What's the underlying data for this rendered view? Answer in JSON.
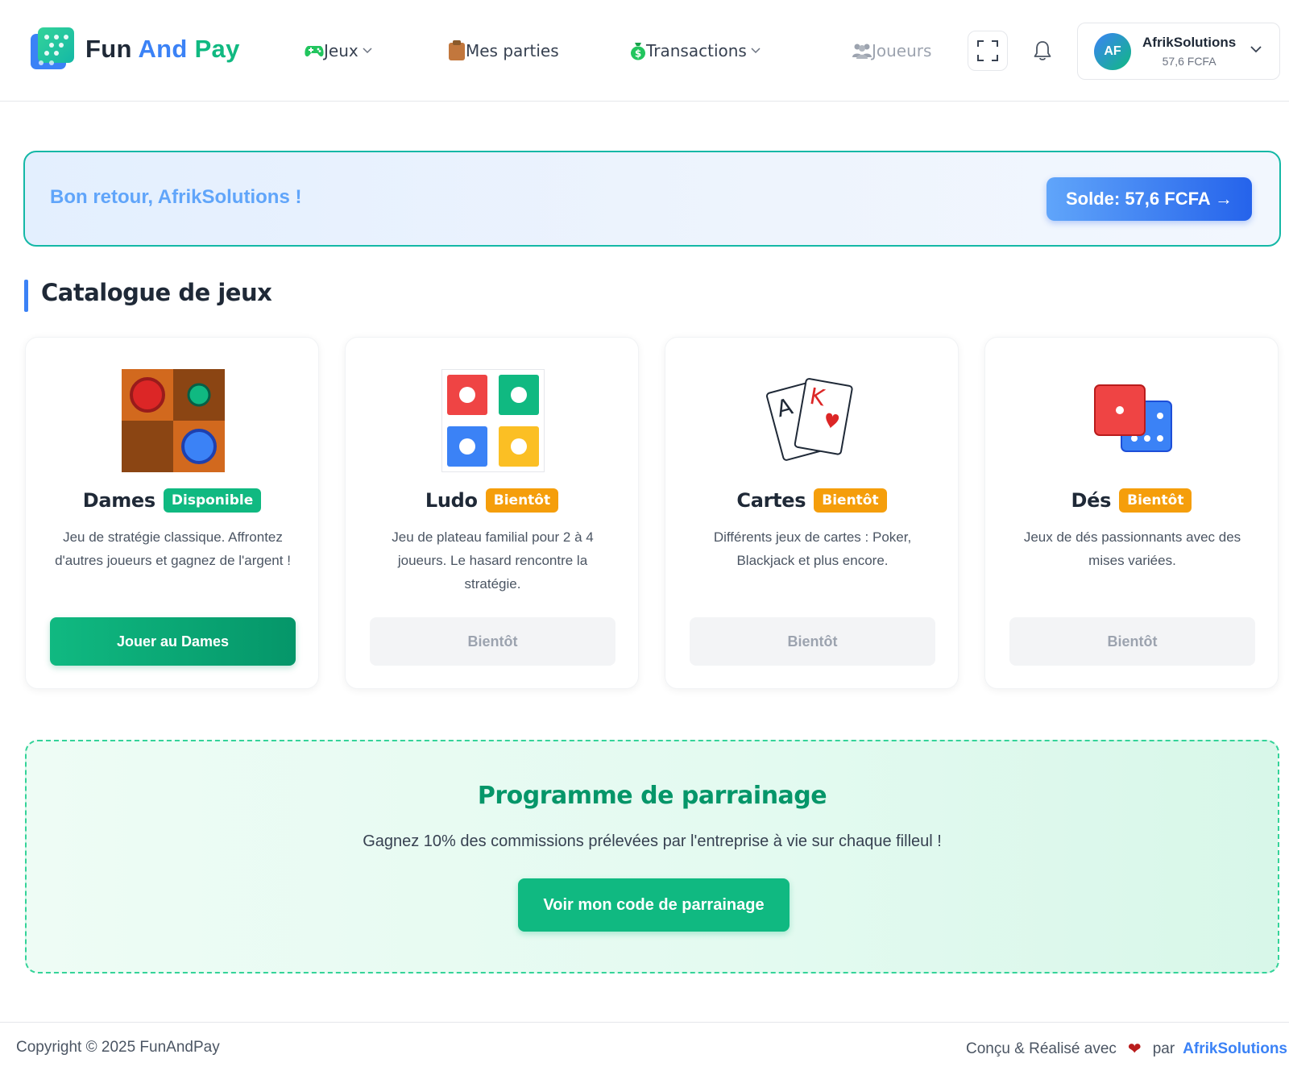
{
  "header": {
    "logo": {
      "word1": "Fun",
      "word2": "And",
      "word3": "Pay"
    },
    "nav": [
      {
        "label": "Jeux",
        "icon": "gamepad-icon",
        "dropdown": true
      },
      {
        "label": "Mes parties",
        "icon": "clipboard-icon",
        "dropdown": false
      },
      {
        "label": "Transactions",
        "icon": "money-bag-icon",
        "dropdown": true
      },
      {
        "label": "Joueurs",
        "icon": "users-icon",
        "dropdown": false,
        "disabled": true
      }
    ],
    "user": {
      "initials": "AF",
      "name": "AfrikSolutions",
      "balance": "57,6 FCFA"
    }
  },
  "banner": {
    "greeting": "Bon retour, AfrikSolutions !",
    "balance_button": "Solde: 57,6 FCFA →"
  },
  "catalog": {
    "title": "Catalogue de jeux",
    "games": [
      {
        "title": "Dames",
        "badge": "Disponible",
        "description": "Jeu de stratégie classique. Affrontez d'autres joueurs et gagnez de l'argent !",
        "button": "Jouer au Dames",
        "icon": "checkers-board-icon"
      },
      {
        "title": "Ludo",
        "badge": "Bientôt",
        "description": "Jeu de plateau familial pour 2 à 4 joueurs. Le hasard rencontre la stratégie.",
        "button": "Bientôt",
        "icon": "ludo-board-icon"
      },
      {
        "title": "Cartes",
        "badge": "Bientôt",
        "description": "Différents jeux de cartes : Poker, Blackjack et plus encore.",
        "button": "Bientôt",
        "icon": "playing-cards-icon"
      },
      {
        "title": "Dés",
        "badge": "Bientôt",
        "description": "Jeux de dés passionnants avec des mises variées.",
        "button": "Bientôt",
        "icon": "dice-icon"
      }
    ]
  },
  "referral": {
    "title": "Programme de parrainage",
    "text": "Gagnez 10% des commissions prélevées par l'entreprise à vie sur chaque filleul !",
    "button": "Voir mon code de parrainage"
  },
  "footer": {
    "copyright": "Copyright © 2025 FunAndPay",
    "credits_prefix": "Conçu & Réalisé avec",
    "credits_by": "par",
    "author": "AfrikSolutions"
  },
  "colors": {
    "primary_blue": "#3b82f6",
    "primary_green": "#10b981",
    "badge_orange": "#f59e0b"
  }
}
